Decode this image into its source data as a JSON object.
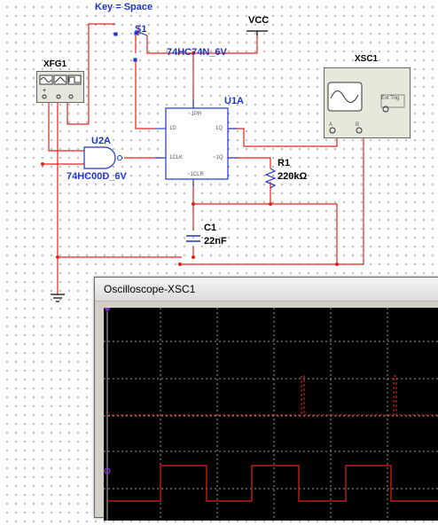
{
  "schematic": {
    "key_label": "Key = Space",
    "switch_label": "S1",
    "vcc_label": "VCC",
    "flipflop_part": "74HC74N_6V",
    "flipflop_ref": "U1A",
    "flipflop_pins": {
      "pr": "~1PR",
      "d": "1D",
      "clk": "1CLK",
      "clr": "~1CLR",
      "q": "1Q",
      "qbar": "~1Q"
    },
    "nand_ref": "U2A",
    "nand_part": "74HC00D_6V",
    "funcgen_ref": "XFG1",
    "scope_ref": "XSC1",
    "scope_ext_trig": "Ext Trig",
    "scope_ch_a": "A",
    "scope_ch_b": "B",
    "resistor_ref": "R1",
    "resistor_value": "220kΩ",
    "capacitor_ref": "C1",
    "capacitor_value": "22nF"
  },
  "oscilloscope": {
    "window_title": "Oscilloscope-XSC1",
    "trace_colors": {
      "channel_a": "#e0241c",
      "channel_b": "#e0241c"
    },
    "grid_color": "#9a9a9a",
    "trigger_marker_color": "#7f2fbf"
  }
}
